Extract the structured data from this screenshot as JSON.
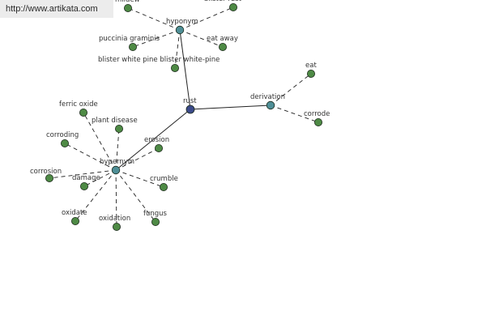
{
  "source": {
    "url": "http://www.artikata.com"
  },
  "graph": {
    "colors": {
      "root": "#3b4a8a",
      "relation": "#4f8f97",
      "term": "#4e8a45",
      "solid_edge": "#222222",
      "dashed_edge": "#222222",
      "node_outline": "#1c2a1c"
    },
    "root": {
      "id": "rust",
      "label": "rust"
    },
    "relations": [
      {
        "id": "hyponym",
        "label": "hyponym",
        "terms": [
          "mildew",
          "blister rust",
          "puccinia graminis",
          "eat away",
          "blister white pine blister white-pine"
        ]
      },
      {
        "id": "derivation",
        "label": "derivation",
        "terms": [
          "eat",
          "corrode"
        ]
      },
      {
        "id": "hypernym",
        "label": "hypernym",
        "terms": [
          "ferric oxide",
          "plant disease",
          "corroding",
          "erosion",
          "corrosion",
          "damage",
          "crumble",
          "oxidate",
          "oxidation",
          "fungus"
        ]
      }
    ]
  }
}
